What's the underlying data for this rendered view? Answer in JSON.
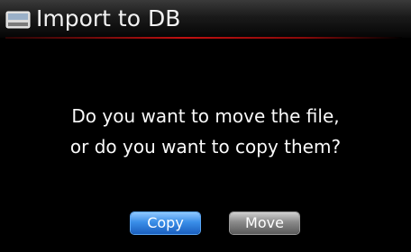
{
  "dialog": {
    "title": "Import to DB",
    "title_icon": "drive-icon",
    "message_line1": "Do you want to move the file,",
    "message_line2": "or do you want to copy them?",
    "buttons": {
      "copy_label": "Copy",
      "move_label": "Move"
    },
    "selected_button": "Copy"
  },
  "colors": {
    "background": "#000000",
    "text": "#ffffff",
    "accent_underline": "#c01010",
    "selected_button": "#3a8ee8",
    "unselected_button": "#8a8a8a"
  }
}
